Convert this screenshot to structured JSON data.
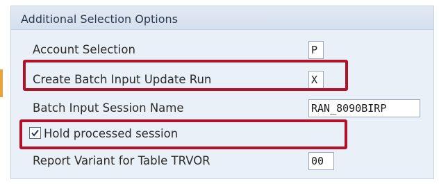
{
  "group": {
    "title": "Additional Selection Options"
  },
  "fields": {
    "account_selection": {
      "label": "Account Selection",
      "value": "P"
    },
    "create_batch_input": {
      "label": "Create Batch Input Update Run",
      "value": "X"
    },
    "batch_session_name": {
      "label": "Batch Input Session Name",
      "value": "RAN_8090BIRP"
    },
    "report_variant": {
      "label": "Report Variant for Table TRVOR",
      "value": "00"
    }
  },
  "checkbox": {
    "hold_processed_session": {
      "label": "Hold processed session",
      "checked": true
    }
  },
  "colors": {
    "highlight": "#b3102a",
    "group_background": "#eaf0f7",
    "header_background": "#d5e0ed"
  }
}
